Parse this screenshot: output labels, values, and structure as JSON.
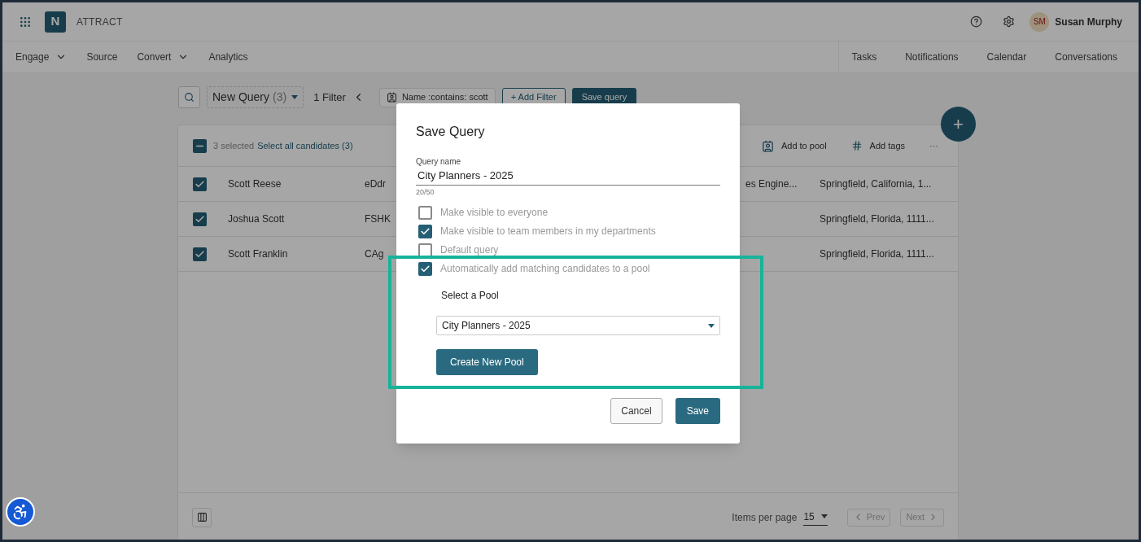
{
  "app": {
    "logo_letter": "N",
    "name": "ATTRACT"
  },
  "user": {
    "initials": "SM",
    "name": "Susan Murphy"
  },
  "nav": [
    {
      "label": "Engage",
      "dropdown": true
    },
    {
      "label": "Source",
      "dropdown": false
    },
    {
      "label": "Convert",
      "dropdown": true
    },
    {
      "label": "Analytics",
      "dropdown": false
    }
  ],
  "nav_right": [
    "Tasks",
    "Notifications",
    "Calendar",
    "Conversations"
  ],
  "toolbar": {
    "query": "New Query",
    "query_count": "(3)",
    "filter_count": "1 Filter",
    "chip": "Name :contains: scott",
    "add_filter": "+ Add Filter",
    "save_query": "Save query"
  },
  "fab": "+",
  "table": {
    "header_indeterminate": true,
    "selected_text": "3 selected",
    "select_all": "Select all candidates (3)",
    "actions": [
      {
        "kind": "pool",
        "label": "Add to pool"
      },
      {
        "kind": "tags",
        "label": "Add tags"
      }
    ],
    "more": "···",
    "rows": [
      {
        "name": "Scott Reese",
        "column_2": "eDdr",
        "column_3": "es Engine...",
        "location": "Springfield, California, 1...",
        "selected": true
      },
      {
        "name": "Joshua Scott",
        "column_2": "FSHK",
        "column_3": "",
        "location": "Springfield, Florida, 1111...",
        "selected": true
      },
      {
        "name": "Scott Franklin",
        "column_2": "CAg",
        "column_3": "",
        "location": "Springfield, Florida, 1111...",
        "selected": true
      }
    ],
    "items_per_page_label": "Items per page",
    "items_per_page": "15",
    "prev": "Prev",
    "next": "Next"
  },
  "modal": {
    "title": "Save Query",
    "field_label": "Query name",
    "field_value": "City Planners - 2025",
    "counter": "20/50",
    "options": [
      {
        "label": "Make visible to everyone",
        "checked": false
      },
      {
        "label": "Make visible to team members in my departments",
        "checked": true
      },
      {
        "label": "Default query",
        "checked": false
      },
      {
        "label": "Automatically add matching candidates to a pool",
        "checked": true
      }
    ],
    "pool_label": "Select a Pool",
    "pool_value": "City Planners - 2025",
    "create_pool": "Create New Pool",
    "cancel": "Cancel",
    "save": "Save"
  }
}
